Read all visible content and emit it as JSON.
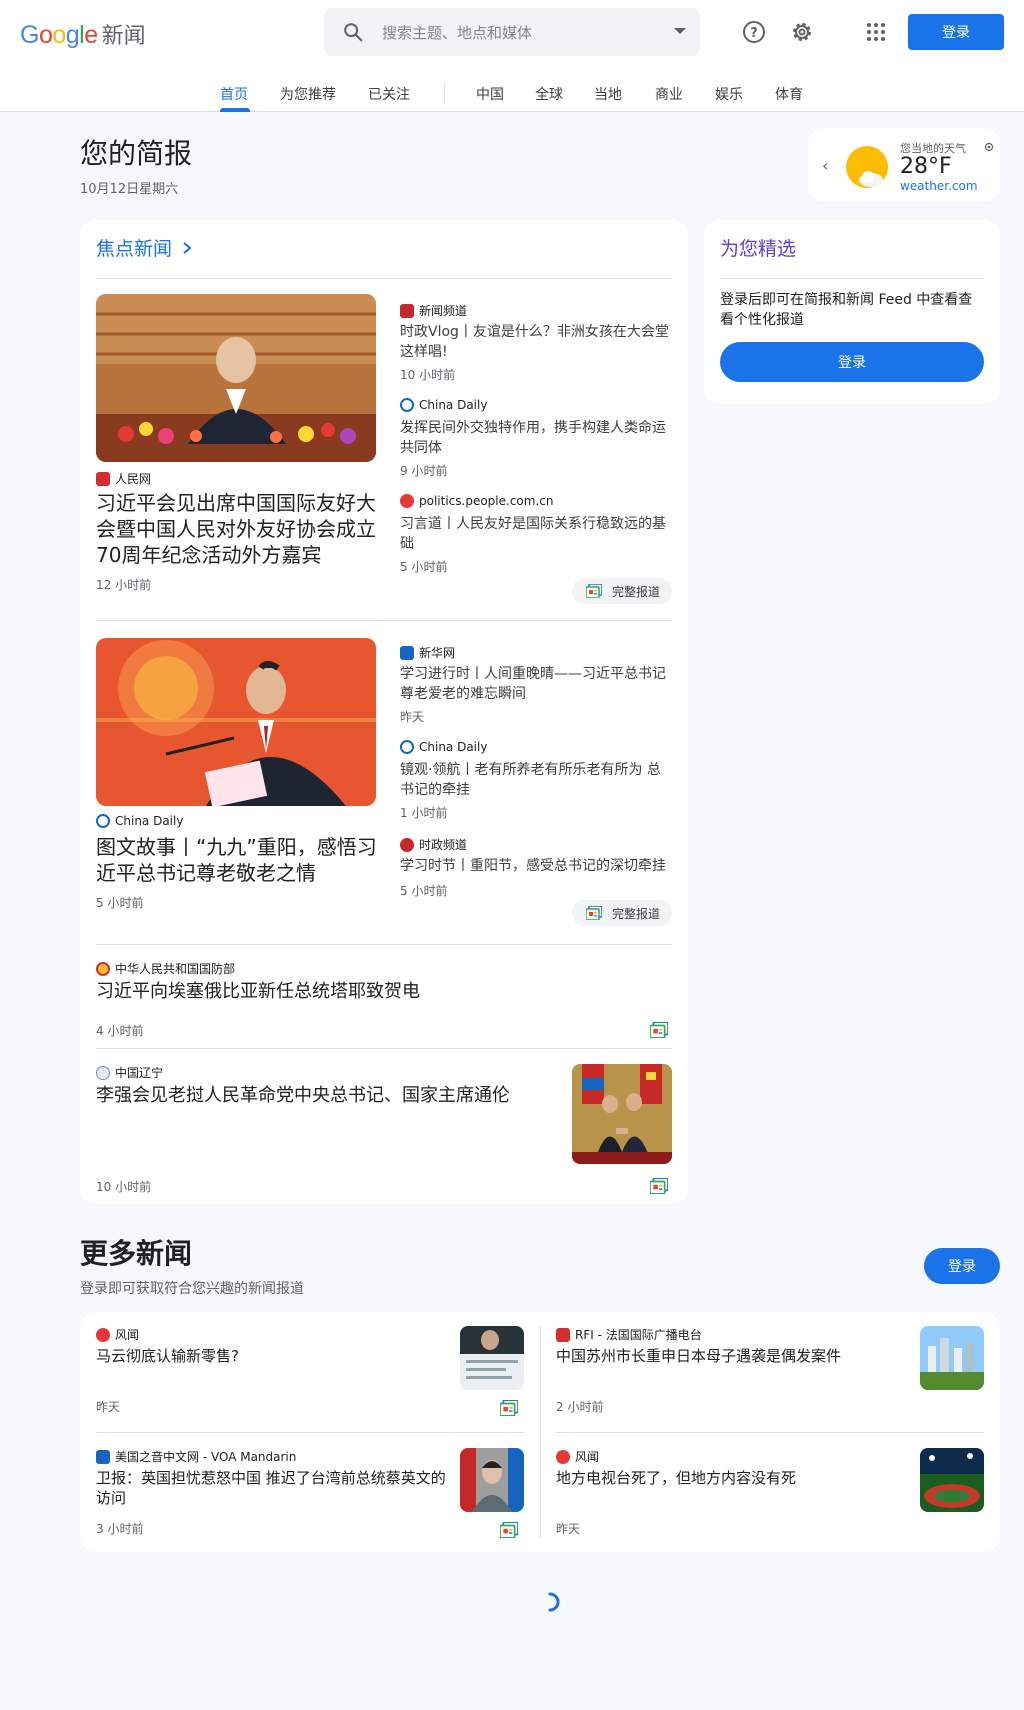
{
  "header": {
    "logo_text": "Google",
    "logo_suffix": "新闻",
    "search_placeholder": "搜索主题、地点和媒体",
    "signin_label": "登录"
  },
  "tabs": [
    {
      "label": "首页",
      "active": true
    },
    {
      "label": "为您推荐"
    },
    {
      "label": "已关注"
    },
    {
      "label": "中国"
    },
    {
      "label": "全球"
    },
    {
      "label": "当地"
    },
    {
      "label": "商业"
    },
    {
      "label": "娱乐"
    },
    {
      "label": "体育"
    }
  ],
  "briefing": {
    "title": "您的简报",
    "date": "10月12日星期六"
  },
  "weather": {
    "label": "您当地的天气",
    "temp": "28°F",
    "source": "weather.com"
  },
  "top_stories": {
    "title": "焦点新闻",
    "cluster1": {
      "main": {
        "source": "人民网",
        "headline": "习近平会见出席中国国际友好大会暨中国人民对外友好协会成立70周年纪念活动外方嘉宾",
        "time": "12 小时前"
      },
      "related": [
        {
          "source": "新闻频道",
          "headline": "时政Vlog丨友谊是什么？非洲女孩在大会堂这样唱!",
          "time": "10 小时前"
        },
        {
          "source": "China Daily",
          "headline": "发挥民间外交独特作用，携手构建人类命运共同体",
          "time": "9 小时前"
        },
        {
          "source": "politics.people.com.cn",
          "headline": "习言道丨人民友好是国际关系行稳致远的基础",
          "time": "5 小时前"
        }
      ],
      "coverage_label": "完整报道"
    },
    "cluster2": {
      "main": {
        "source": "China Daily",
        "headline": "图文故事丨“九九”重阳，感悟习近平总书记尊老敬老之情",
        "time": "5 小时前"
      },
      "related": [
        {
          "source": "新华网",
          "headline": "学习进行时丨人间重晚晴——习近平总书记尊老爱老的难忘瞬间",
          "time": "昨天"
        },
        {
          "source": "China Daily",
          "headline": "镜观·领航丨老有所养老有所乐老有所为 总书记的牵挂",
          "time": "1 小时前"
        },
        {
          "source": "时政频道",
          "headline": "学习时节丨重阳节，感受总书记的深切牵挂",
          "time": "5 小时前"
        }
      ],
      "coverage_label": "完整报道"
    },
    "story3": {
      "source": "中华人民共和国国防部",
      "headline": "习近平向埃塞俄比亚新任总统塔耶致贺电",
      "time": "4 小时前"
    },
    "story4": {
      "source": "中国辽宁",
      "headline": "李强会见老挝人民革命党中央总书记、国家主席通伦",
      "time": "10 小时前"
    }
  },
  "picks": {
    "title": "为您精选",
    "text": "登录后即可在简报和新闻 Feed 中查看查看个性化报道",
    "button": "登录"
  },
  "more_news": {
    "title": "更多新闻",
    "subtitle": "登录即可获取符合您兴趣的新闻报道",
    "button": "登录",
    "items": [
      {
        "source": "风闻",
        "headline": "马云彻底认输新零售?",
        "time": "昨天"
      },
      {
        "source": "RFI - 法国国际广播电台",
        "headline": "中国苏州市长重申日本母子遇袭是偶发案件",
        "time": "2 小时前"
      },
      {
        "source": "美国之音中文网 - VOA Mandarin",
        "headline": "卫报：英国担忧惹怒中国 推迟了台湾前总统蔡英文的访问",
        "time": "3 小时前"
      },
      {
        "source": "风闻",
        "headline": "地方电视台死了，但地方内容没有死",
        "time": "昨天"
      }
    ]
  },
  "colors": {
    "accent": "#1a73e8",
    "picks_title": "#5b3fd6",
    "background": "#f6f8fc"
  }
}
